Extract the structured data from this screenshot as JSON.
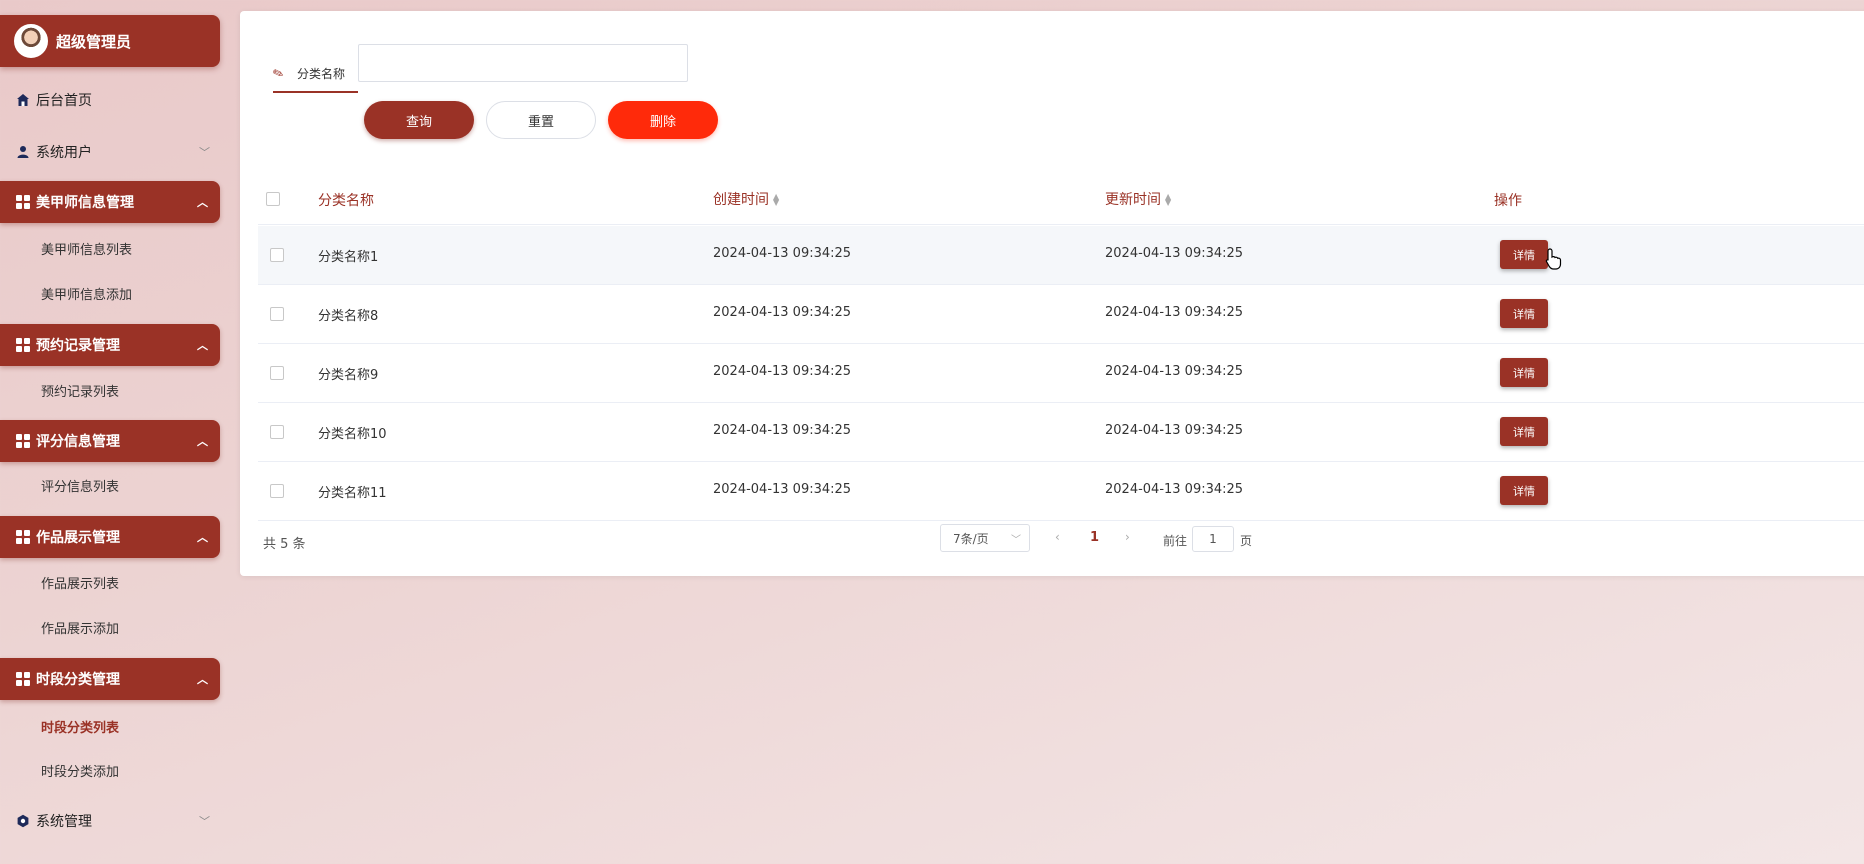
{
  "user": {
    "name": "超级管理员"
  },
  "nav": {
    "home": "后台首页",
    "users": "系统用户",
    "groups": [
      {
        "label": "美甲师信息管理",
        "items": [
          "美甲师信息列表",
          "美甲师信息添加"
        ]
      },
      {
        "label": "预约记录管理",
        "items": [
          "预约记录列表"
        ]
      },
      {
        "label": "评分信息管理",
        "items": [
          "评分信息列表"
        ]
      },
      {
        "label": "作品展示管理",
        "items": [
          "作品展示列表",
          "作品展示添加"
        ]
      },
      {
        "label": "时段分类管理",
        "items": [
          "时段分类列表",
          "时段分类添加"
        ]
      }
    ],
    "system": "系统管理"
  },
  "search": {
    "label": "分类名称",
    "value": "",
    "placeholder": ""
  },
  "buttons": {
    "query": "查询",
    "reset": "重置",
    "delete": "删除"
  },
  "table": {
    "headers": {
      "name": "分类名称",
      "created": "创建时间",
      "updated": "更新时间",
      "action": "操作"
    },
    "rows": [
      {
        "name": "分类名称1",
        "created": "2024-04-13 09:34:25",
        "updated": "2024-04-13 09:34:25",
        "action": "详情"
      },
      {
        "name": "分类名称8",
        "created": "2024-04-13 09:34:25",
        "updated": "2024-04-13 09:34:25",
        "action": "详情"
      },
      {
        "name": "分类名称9",
        "created": "2024-04-13 09:34:25",
        "updated": "2024-04-13 09:34:25",
        "action": "详情"
      },
      {
        "name": "分类名称10",
        "created": "2024-04-13 09:34:25",
        "updated": "2024-04-13 09:34:25",
        "action": "详情"
      },
      {
        "name": "分类名称11",
        "created": "2024-04-13 09:34:25",
        "updated": "2024-04-13 09:34:25",
        "action": "详情"
      }
    ]
  },
  "pagination": {
    "total": "共 5 条",
    "page_size": "7条/页",
    "current_page": "1",
    "goto_label": "前往",
    "goto_value": "1",
    "goto_suffix": "页"
  },
  "colors": {
    "accent": "#9a3226",
    "danger": "#ff2a0a"
  },
  "icons": [
    "home-icon",
    "user-icon",
    "grid-icon",
    "gear-icon",
    "pen-icon",
    "sort-icon",
    "pointer-cursor-icon"
  ]
}
